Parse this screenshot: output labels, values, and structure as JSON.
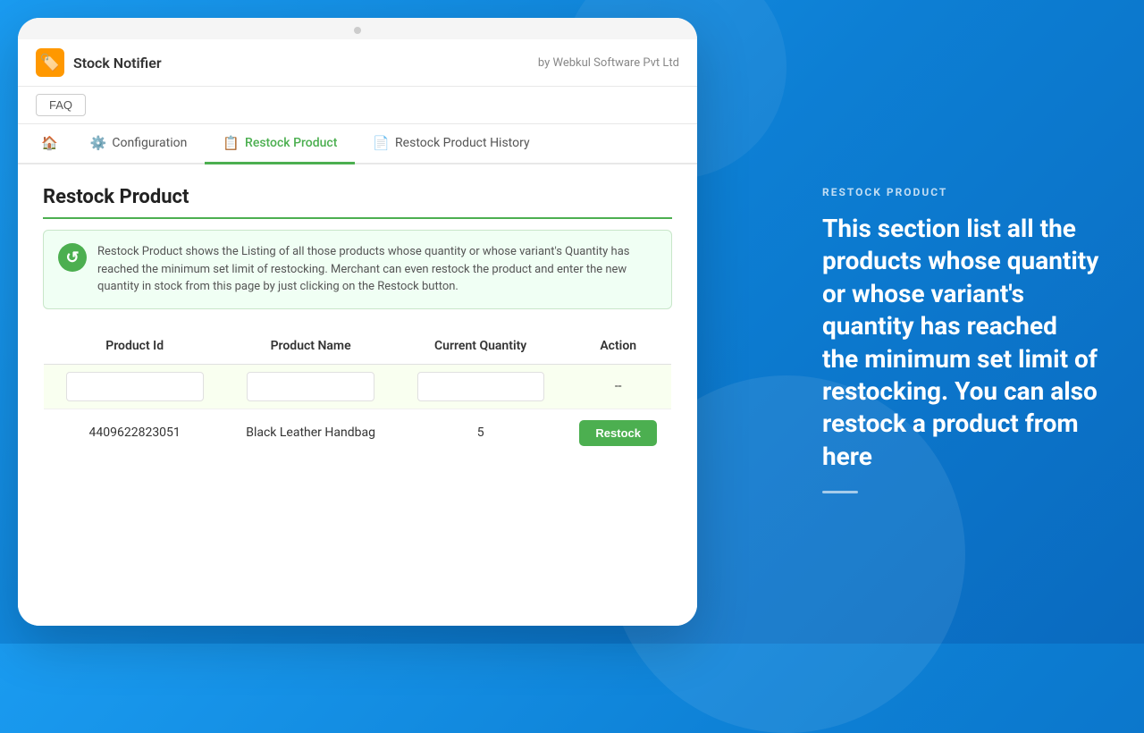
{
  "app": {
    "title": "Stock Notifier",
    "subtitle": "by Webkul Software Pvt Ltd",
    "logo_emoji": "🏷️"
  },
  "faq": {
    "label": "FAQ"
  },
  "nav": {
    "home_icon": "🏠",
    "tabs": [
      {
        "id": "home",
        "label": "",
        "icon": "🏠",
        "active": false
      },
      {
        "id": "configuration",
        "label": "Configuration",
        "icon": "⚙️",
        "active": false
      },
      {
        "id": "restock-product",
        "label": "Restock Product",
        "icon": "📋",
        "active": true
      },
      {
        "id": "restock-product-history",
        "label": "Restock Product History",
        "icon": "📄",
        "active": false
      }
    ]
  },
  "page": {
    "title": "Restock Product",
    "info_text": "Restock Product shows the Listing of all those products whose quantity or whose variant's Quantity has reached the minimum set limit of restocking. Merchant can even restock the product and enter the new quantity in stock from this page by just clicking on the Restock button."
  },
  "table": {
    "columns": [
      "Product Id",
      "Product Name",
      "Current Quantity",
      "Action"
    ],
    "filter_placeholder": "",
    "filter_action": "--",
    "rows": [
      {
        "product_id": "4409622823051",
        "product_name": "Black Leather Handbag",
        "current_quantity": "5",
        "action": "Restock"
      }
    ]
  },
  "right_panel": {
    "label": "RESTOCK PRODUCT",
    "description": "This section list all the products whose quantity or whose variant's quantity has reached the minimum set limit of restocking. You can also restock a product from here"
  }
}
